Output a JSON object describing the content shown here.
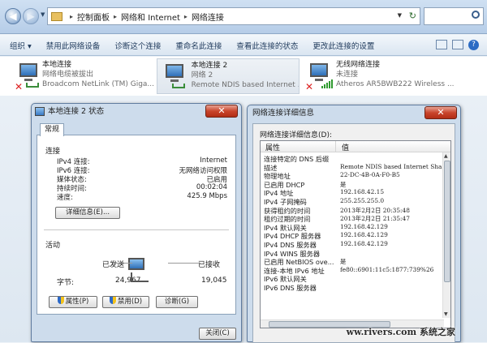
{
  "address_bar": {
    "crumbs": [
      "控制面板",
      "网络和 Internet",
      "网络连接"
    ],
    "back_glyph": "◀",
    "forward_glyph": "▶",
    "refresh_glyph": "↻"
  },
  "toolbar": {
    "items": [
      "组织 ▾",
      "禁用此网络设备",
      "诊断这个连接",
      "重命名此连接",
      "查看此连接的状态",
      "更改此连接的设置"
    ]
  },
  "connections": [
    {
      "name": "本地连接",
      "status": "网络电缆被拔出",
      "device": "Broadcom NetLink (TM) Giga...",
      "icon": "wired-disconnected-icon"
    },
    {
      "name": "本地连接 2",
      "status": "网络  2",
      "device": "Remote NDIS based Internet ...",
      "icon": "wired-connected-icon"
    },
    {
      "name": "无线网络连接",
      "status": "未连接",
      "device": "Atheros AR5BWB222 Wireless ...",
      "icon": "wireless-disconnected-icon"
    }
  ],
  "status_dialog": {
    "title": "本地连接 2 状态",
    "close_glyph": "✕",
    "tab": "常规",
    "section_connection": "连接",
    "fields": [
      {
        "label": "IPv4 连接:",
        "value": "Internet"
      },
      {
        "label": "IPv6 连接:",
        "value": "无网络访问权限"
      },
      {
        "label": "媒体状态:",
        "value": "已启用"
      },
      {
        "label": "持续时间:",
        "value": "00:02:04"
      },
      {
        "label": "速度:",
        "value": "425.9 Mbps"
      }
    ],
    "details_button": "详细信息(E)...",
    "section_activity": "活动",
    "sent_label": "已发送",
    "received_label": "已接收",
    "bytes_label": "字节:",
    "bytes_sent": "24,967",
    "bytes_received": "19,045",
    "properties_button": "属性(P)",
    "disable_button": "禁用(D)",
    "diagnose_button": "诊断(G)",
    "close_button": "关闭(C)"
  },
  "details_dialog": {
    "title": "网络连接详细信息",
    "close_glyph": "✕",
    "list_label": "网络连接详细信息(D):",
    "col_property": "属性",
    "col_value": "值",
    "rows": [
      {
        "k": "连接特定的 DNS 后缀",
        "v": ""
      },
      {
        "k": "描述",
        "v": "Remote NDIS based Internet Sha"
      },
      {
        "k": "物理地址",
        "v": "22-DC-4B-0A-F0-B5"
      },
      {
        "k": "已启用 DHCP",
        "v": "是"
      },
      {
        "k": "IPv4 地址",
        "v": "192.168.42.15"
      },
      {
        "k": "IPv4 子网掩码",
        "v": "255.255.255.0"
      },
      {
        "k": "获得租约的时间",
        "v": "2013年2月2日 20:35:48"
      },
      {
        "k": "租约过期的时间",
        "v": "2013年2月2日 21:35:47"
      },
      {
        "k": "IPv4 默认网关",
        "v": "192.168.42.129"
      },
      {
        "k": "IPv4 DHCP 服务器",
        "v": "192.168.42.129"
      },
      {
        "k": "IPv4 DNS 服务器",
        "v": "192.168.42.129"
      },
      {
        "k": "IPv4 WINS 服务器",
        "v": ""
      },
      {
        "k": "已启用 NetBIOS ove...",
        "v": "是"
      },
      {
        "k": "连接-本地 IPv6 地址",
        "v": "fe80::6901:11c5:1877:739%26"
      },
      {
        "k": "IPv6 默认网关",
        "v": ""
      },
      {
        "k": "IPv6 DNS 服务器",
        "v": ""
      }
    ],
    "watermark": "ww.rivers.com 系统之家"
  }
}
